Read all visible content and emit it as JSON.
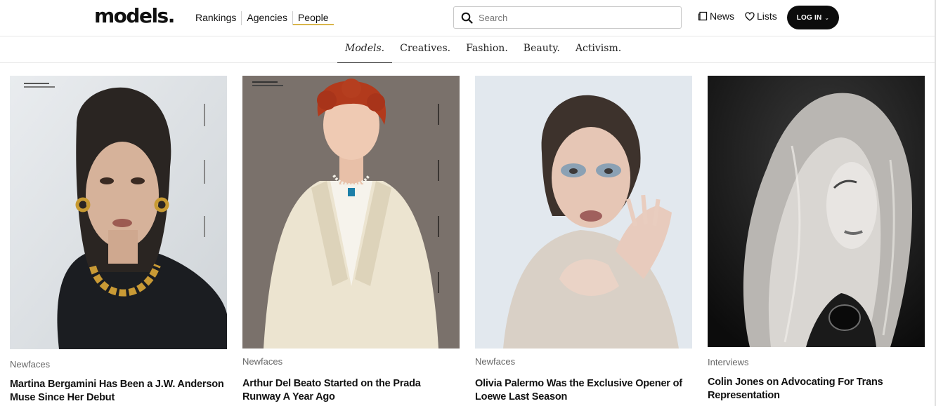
{
  "header": {
    "logo": "models.",
    "nav": [
      "Rankings",
      "Agencies",
      "People"
    ],
    "active_nav": "People",
    "search_placeholder": "Search",
    "news_label": "News",
    "lists_label": "Lists",
    "login_label": "LOG IN",
    "colors": {
      "accent_underline": "#d9b64b",
      "login_bg": "#0c0c0c"
    }
  },
  "subnav": {
    "items": [
      "Models.",
      "Creatives.",
      "Fashion.",
      "Beauty.",
      "Activism."
    ],
    "active": "Models."
  },
  "cards": [
    {
      "category": "Newfaces",
      "headline": "Martina Bergamini Has Been a J.W. Anderson Muse Since Her Debut"
    },
    {
      "category": "Newfaces",
      "headline": "Arthur Del Beato Started on the Prada Runway A Year Ago"
    },
    {
      "category": "Newfaces",
      "headline": "Olivia Palermo Was the Exclusive Opener of Loewe Last Season"
    },
    {
      "category": "Interviews",
      "headline": "Colin Jones on Advocating For Trans Representation"
    }
  ]
}
